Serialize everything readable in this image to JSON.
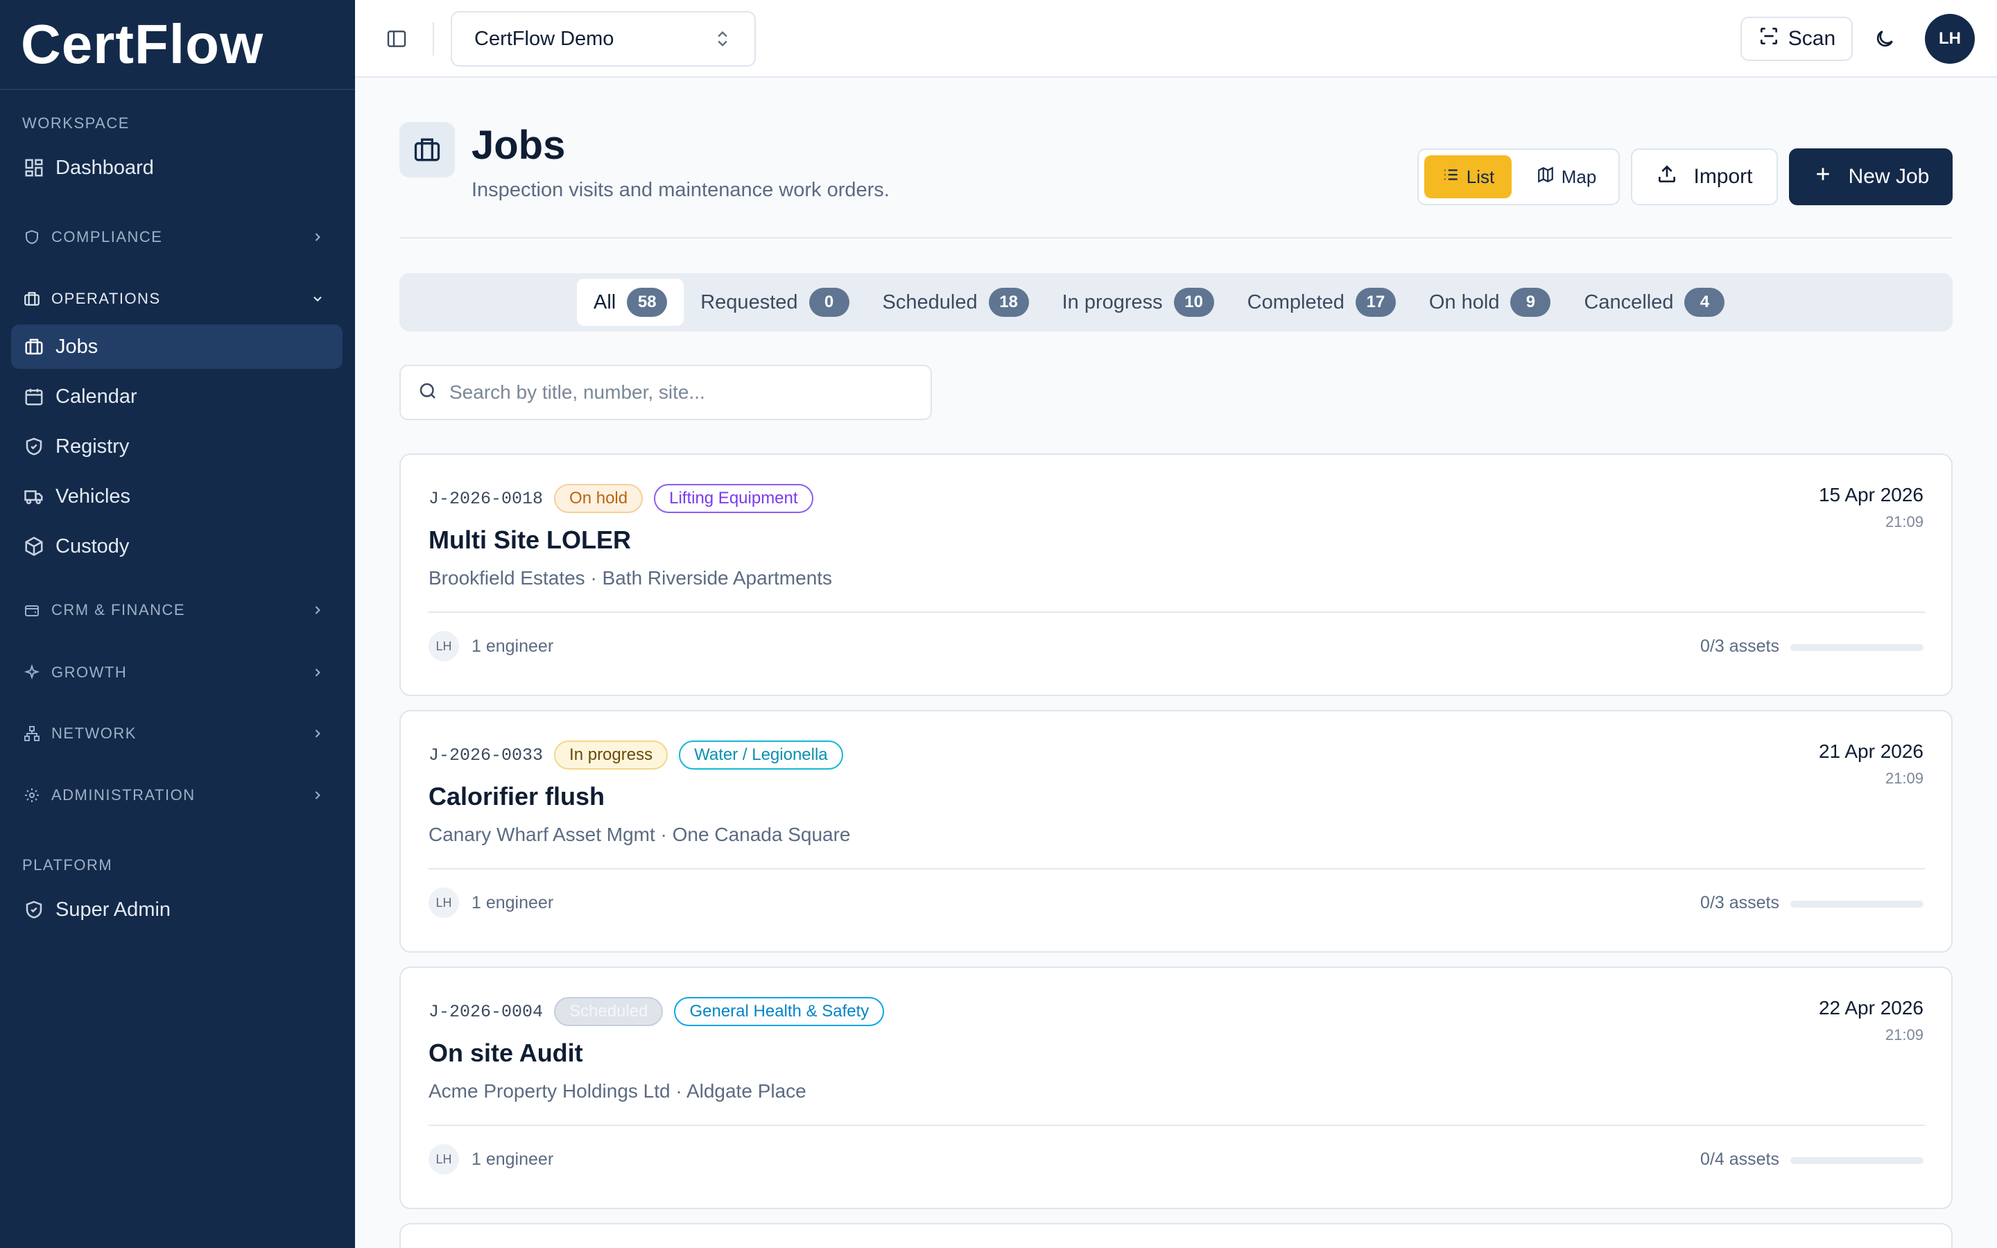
{
  "app": {
    "brand": "CertFlow"
  },
  "sidebar": {
    "workspace_label": "WORKSPACE",
    "dashboard": "Dashboard",
    "compliance": "COMPLIANCE",
    "operations": "OPERATIONS",
    "ops_items": [
      "Jobs",
      "Calendar",
      "Registry",
      "Vehicles",
      "Custody"
    ],
    "crm": "CRM & FINANCE",
    "growth": "GROWTH",
    "network": "NETWORK",
    "administration": "ADMINISTRATION",
    "platform_label": "PLATFORM",
    "super_admin": "Super Admin"
  },
  "topbar": {
    "workspace": "CertFlow Demo",
    "scan_label": "Scan",
    "user_initials": "LH"
  },
  "page": {
    "title": "Jobs",
    "subtitle": "Inspection visits and maintenance work orders.",
    "view_list": "List",
    "view_map": "Map",
    "import_label": "Import",
    "new_job_label": "New Job"
  },
  "filters": [
    {
      "label": "All",
      "count": "58"
    },
    {
      "label": "Requested",
      "count": "0"
    },
    {
      "label": "Scheduled",
      "count": "18"
    },
    {
      "label": "In progress",
      "count": "10"
    },
    {
      "label": "Completed",
      "count": "17"
    },
    {
      "label": "On hold",
      "count": "9"
    },
    {
      "label": "Cancelled",
      "count": "4"
    }
  ],
  "search": {
    "placeholder": "Search by title, number, site..."
  },
  "jobs": [
    {
      "number": "J-2026-0018",
      "status": "On hold",
      "category": "Lifting Equipment",
      "title": "Multi Site LOLER",
      "client_site": "Brookfield Estates · Bath Riverside Apartments",
      "date": "15 Apr 2026",
      "time": "21:09",
      "engineer_initials": "LH",
      "engineers": "1 engineer",
      "assets": "0/3 assets",
      "assets_progress": 0
    },
    {
      "number": "J-2026-0033",
      "status": "In progress",
      "category": "Water / Legionella",
      "title": "Calorifier flush",
      "client_site": "Canary Wharf Asset Mgmt · One Canada Square",
      "date": "21 Apr 2026",
      "time": "21:09",
      "engineer_initials": "LH",
      "engineers": "1 engineer",
      "assets": "0/3 assets",
      "assets_progress": 0
    },
    {
      "number": "J-2026-0004",
      "status": "Scheduled",
      "category": "General Health & Safety",
      "title": "On site Audit",
      "client_site": "Acme Property Holdings Ltd · Aldgate Place",
      "date": "22 Apr 2026",
      "time": "21:09",
      "engineer_initials": "LH",
      "engineers": "1 engineer",
      "assets": "0/4 assets",
      "assets_progress": 0
    }
  ],
  "colors": {
    "sidebar_bg": "#142a4a",
    "accent_yellow": "#f5b922",
    "primary_navy": "#142a4a",
    "count_badge": "#5f7591"
  }
}
